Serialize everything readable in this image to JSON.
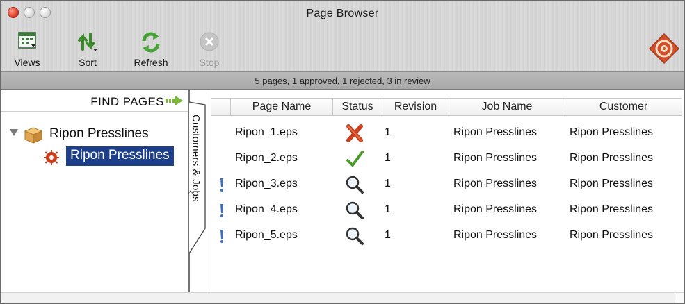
{
  "window": {
    "title": "Page Browser"
  },
  "toolbar": {
    "items": [
      {
        "label": "Views",
        "icon": "views-icon",
        "enabled": true
      },
      {
        "label": "Sort",
        "icon": "sort-icon",
        "enabled": true
      },
      {
        "label": "Refresh",
        "icon": "refresh-icon",
        "enabled": true
      },
      {
        "label": "Stop",
        "icon": "stop-icon",
        "enabled": false
      }
    ],
    "logo_icon": "app-logo-icon"
  },
  "status": {
    "summary": "5 pages, 1 approved, 1 rejected, 3 in review"
  },
  "left": {
    "find_label": "FIND PAGES",
    "tree": {
      "parent": {
        "label": "Ripon Presslines",
        "icon": "package-icon",
        "expanded": true
      },
      "child": {
        "label": "Ripon Presslines",
        "icon": "gear-icon",
        "selected": true
      }
    },
    "drawer_label": "Customers & Jobs"
  },
  "table": {
    "columns": [
      "Page Name",
      "Status",
      "Revision",
      "Job Name",
      "Customer"
    ],
    "rows": [
      {
        "flag": false,
        "page": "Ripon_1.eps",
        "status": "rejected",
        "revision": "1",
        "job": "Ripon Presslines",
        "customer": "Ripon Presslines"
      },
      {
        "flag": false,
        "page": "Ripon_2.eps",
        "status": "approved",
        "revision": "1",
        "job": "Ripon Presslines",
        "customer": "Ripon Presslines"
      },
      {
        "flag": true,
        "page": "Ripon_3.eps",
        "status": "in-review",
        "revision": "1",
        "job": "Ripon Presslines",
        "customer": "Ripon Presslines"
      },
      {
        "flag": true,
        "page": "Ripon_4.eps",
        "status": "in-review",
        "revision": "1",
        "job": "Ripon Presslines",
        "customer": "Ripon Presslines"
      },
      {
        "flag": true,
        "page": "Ripon_5.eps",
        "status": "in-review",
        "revision": "1",
        "job": "Ripon Presslines",
        "customer": "Ripon Presslines"
      }
    ]
  },
  "colors": {
    "selection": "#1e3f8a",
    "rejected": "#c8401e",
    "approved": "#4a9a2a",
    "arrow": "#7ab83a"
  }
}
